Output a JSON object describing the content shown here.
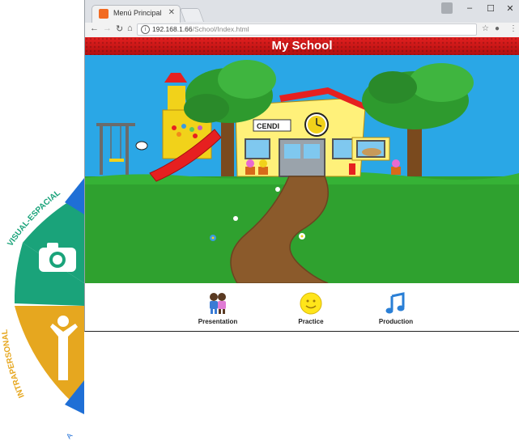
{
  "wheel": {
    "label_top": "VISUAL-ESPACIAL",
    "label_bottom": "INTRAPERSONAL",
    "label_corner": "A"
  },
  "browser": {
    "tab_title": "Menú Principal",
    "url_host": "192.168.1.66",
    "url_path": "/School/Index.html"
  },
  "page": {
    "title": "My School",
    "sign_text": "CENDI",
    "menu": [
      {
        "label": "Presentation",
        "icon": "children-icon"
      },
      {
        "label": "Practice",
        "icon": "smiley-icon"
      },
      {
        "label": "Production",
        "icon": "music-note-icon"
      }
    ]
  },
  "colors": {
    "header_red": "#d21818",
    "sky": "#2aa7e6",
    "grass": "#2fa12f",
    "path": "#8b5a2b",
    "building": "#fff17a",
    "wheel_green": "#1aa37a",
    "wheel_yellow": "#e6a71f",
    "wheel_blue": "#1f6fd6"
  }
}
